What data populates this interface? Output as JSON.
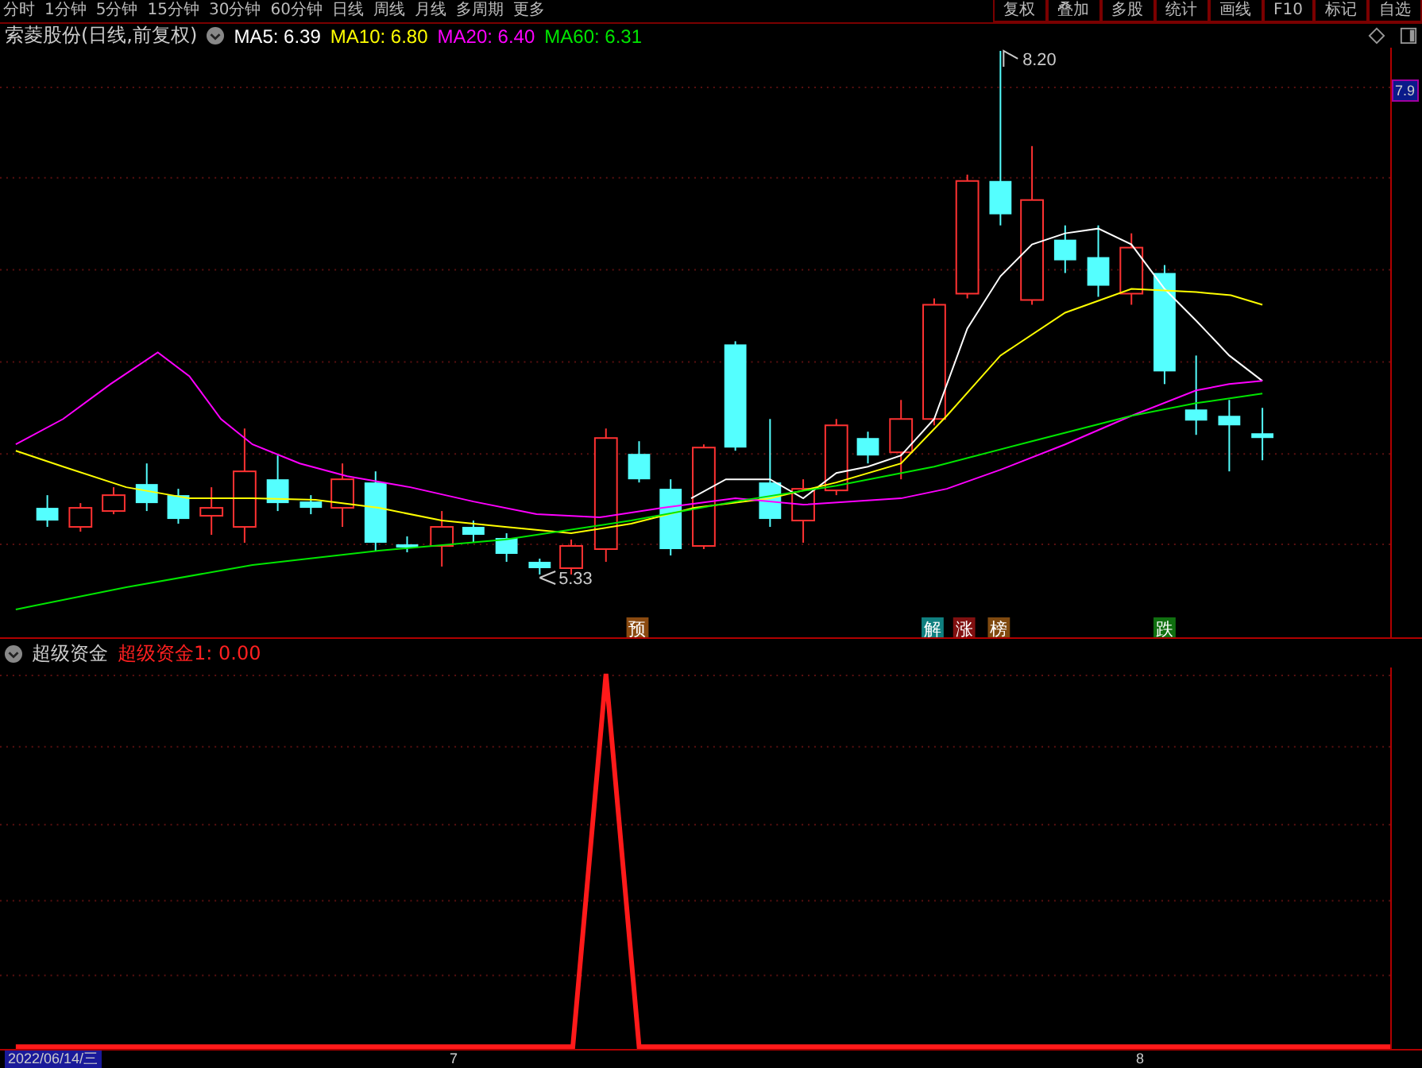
{
  "toolbar": {
    "periods": [
      "分时",
      "1分钟",
      "5分钟",
      "15分钟",
      "30分钟",
      "60分钟",
      "日线",
      "周线",
      "月线",
      "多周期",
      "更多"
    ],
    "buttons": [
      "复权",
      "叠加",
      "多股",
      "统计",
      "画线",
      "F10",
      "标记",
      "自选"
    ]
  },
  "main_panel": {
    "stock_name": "索菱股份(日线,前复权)",
    "indicators": [
      {
        "label": "MA5: 6.39",
        "color": "#ffffff"
      },
      {
        "label": "MA10: 6.80",
        "color": "#ffff00"
      },
      {
        "label": "MA20: 6.40",
        "color": "#ff00ff"
      },
      {
        "label": "MA60: 6.31",
        "color": "#00e600"
      }
    ],
    "high_label": "8.20",
    "low_label": "5.33",
    "price_tag": "7.9",
    "signals": [
      {
        "text": "预",
        "color": "#8a4a10"
      },
      {
        "text": "解",
        "color": "#108080"
      },
      {
        "text": "涨",
        "color": "#801010"
      },
      {
        "text": "榜",
        "color": "#804a10"
      },
      {
        "text": "跌",
        "color": "#107010"
      }
    ]
  },
  "sub_panel": {
    "name": "超级资金",
    "value_label": "超级资金1: 0.00"
  },
  "time_axis": {
    "cursor_date": "2022/06/14/三",
    "labels": [
      "7",
      "8"
    ]
  }
}
